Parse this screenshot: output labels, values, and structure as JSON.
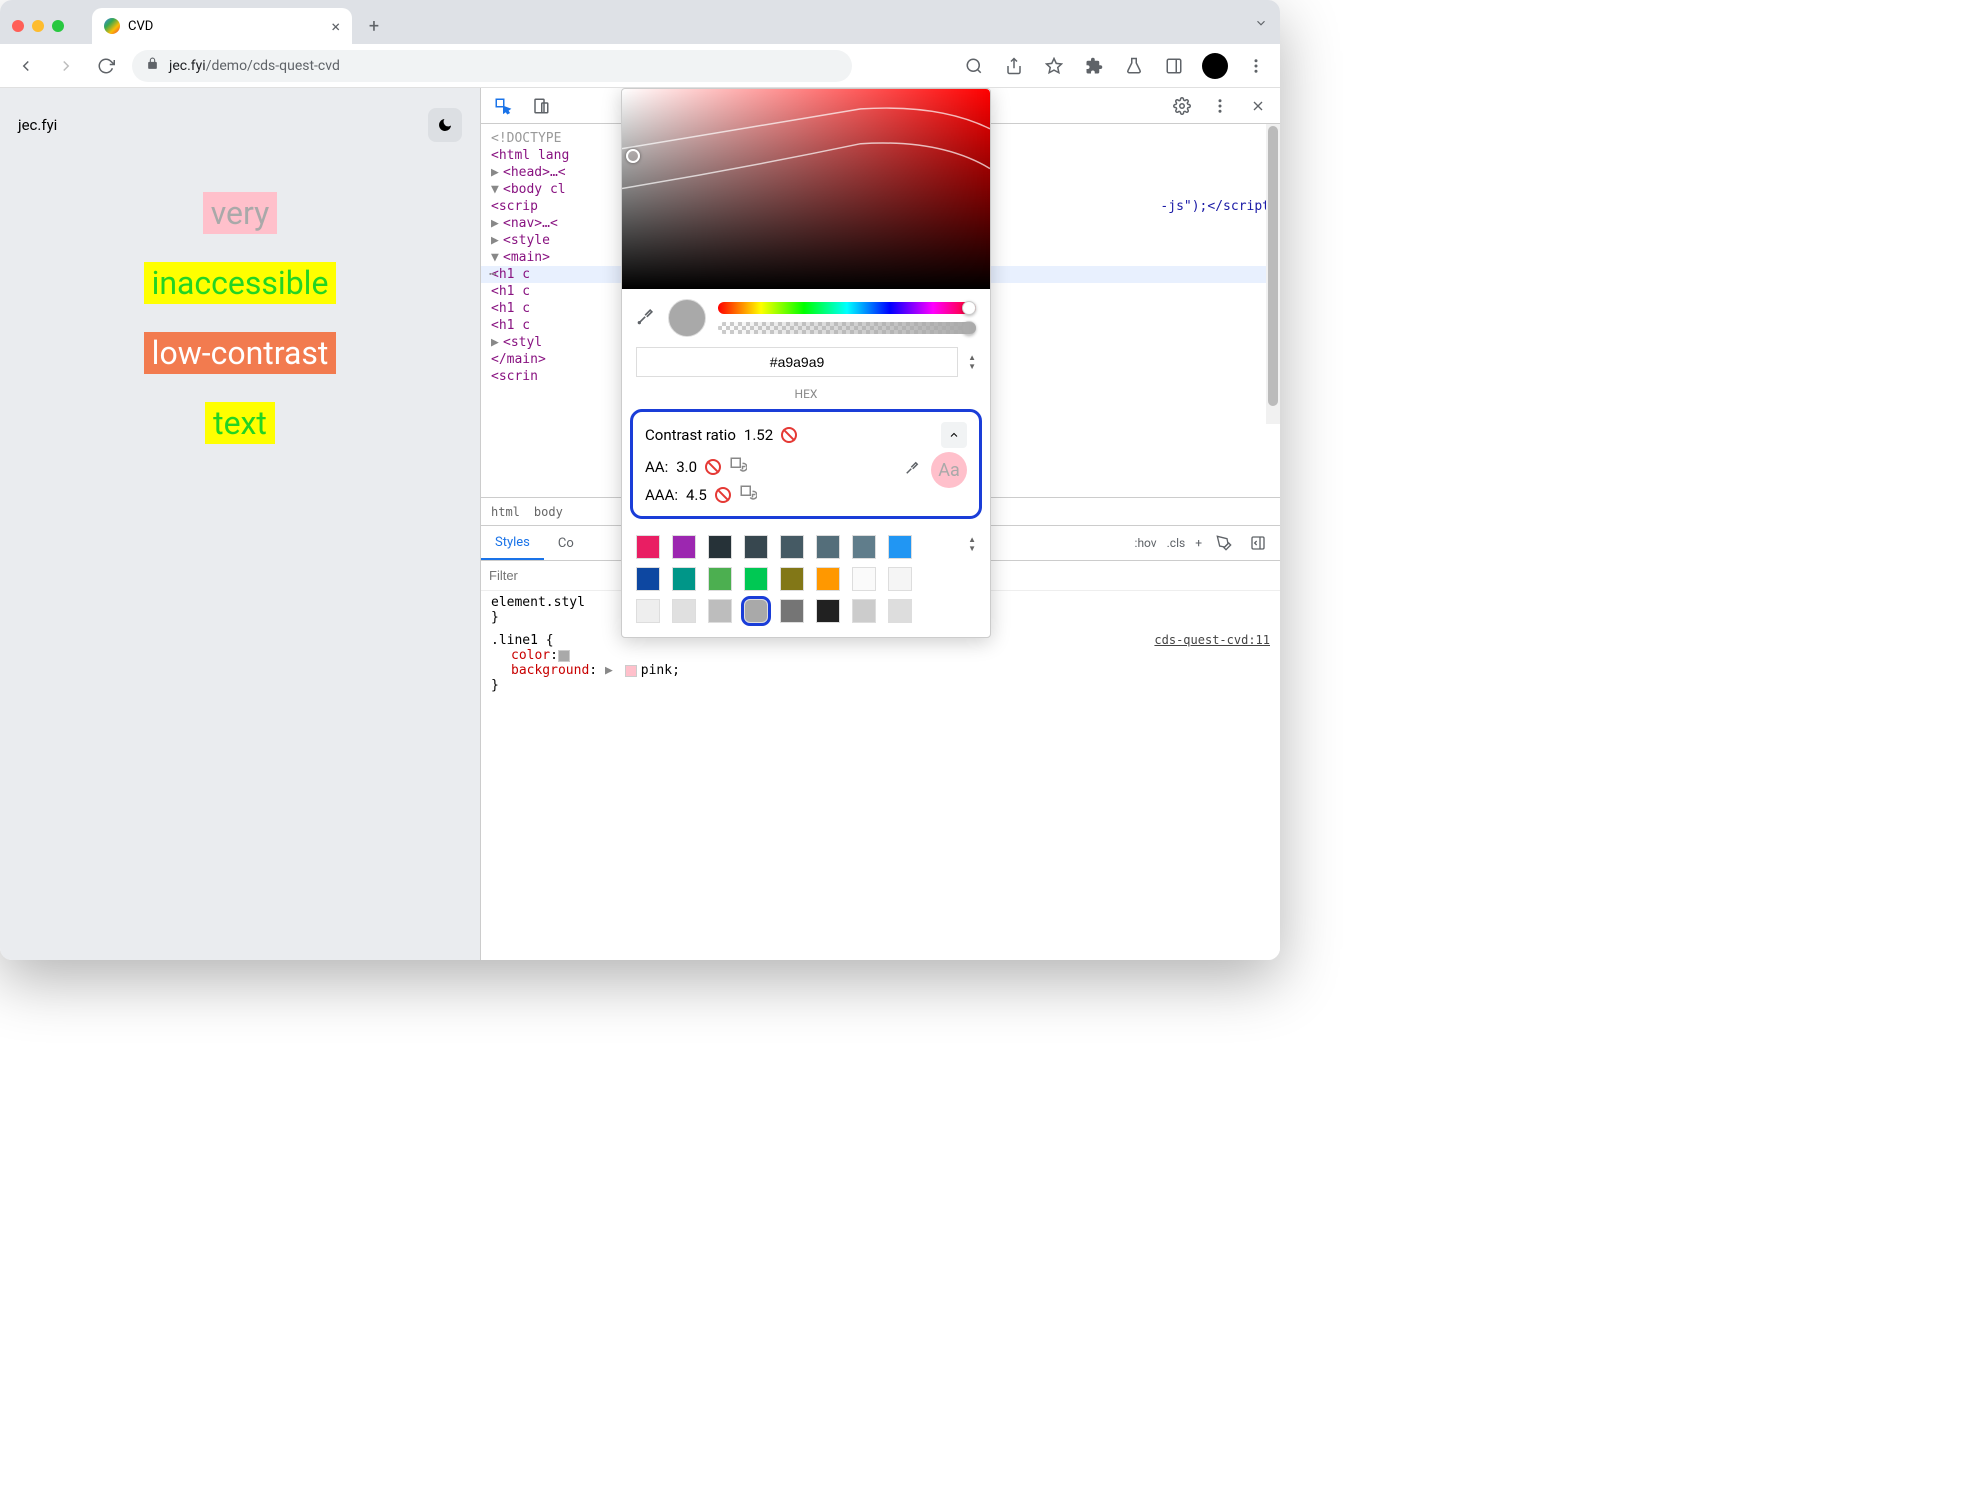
{
  "tab": {
    "title": "CVD"
  },
  "url": {
    "domain": "jec.fyi",
    "path": "/demo/cds-quest-cvd"
  },
  "page": {
    "site_title": "jec.fyi",
    "lines": [
      "very",
      "inaccessible",
      "low-contrast",
      "text"
    ]
  },
  "elements": {
    "doctype": "<!DOCTYPE",
    "html_open": "<html lang",
    "head": "<head>…<",
    "body": "<body cl",
    "script_partial": "<scrip",
    "script_end": "-js\");</script",
    "nav": "<nav>…<",
    "style1": "<style",
    "main": "<main>",
    "h1a": "<h1 c",
    "h1b": "<h1 c",
    "h1c": "<h1 c",
    "h1d": "<h1 c",
    "style2": "<styl",
    "main_close": "</main>",
    "script2": "<scrin"
  },
  "breadcrumb": [
    "html",
    "body"
  ],
  "styles_tabs": {
    "active": "Styles",
    "other": "Co"
  },
  "filter_placeholder": "Filter",
  "toolbar_right": {
    "hov": ":hov",
    "cls": ".cls"
  },
  "rules": {
    "element_style": "element.styl",
    "selector": ".line1 {",
    "source": "cds-quest-cvd:11",
    "color_prop": "color",
    "color_val_partial": "",
    "bg_prop": "background",
    "bg_val": "pink"
  },
  "picker": {
    "hex": "#a9a9a9",
    "hex_label": "HEX",
    "contrast_label": "Contrast ratio",
    "contrast_value": "1.52",
    "aa_label": "AA:",
    "aa_value": "3.0",
    "aaa_label": "AAA:",
    "aaa_value": "4.5",
    "aa_sample": "Aa",
    "palette": [
      "#e91e63",
      "#9c27b0",
      "#263238",
      "#37474f",
      "#455a64",
      "#546e7a",
      "#607d8b",
      "#2196f3",
      "#0d47a1",
      "#009688",
      "#4caf50",
      "#00c853",
      "#827717",
      "#ff9800",
      "#fafafa",
      "#f5f5f5",
      "#eeeeee",
      "#e0e0e0",
      "#bdbdbd",
      "#a9a9a9",
      "#757575",
      "#212121",
      "#ccc",
      "#ddd"
    ],
    "selected_palette_index": 19
  }
}
